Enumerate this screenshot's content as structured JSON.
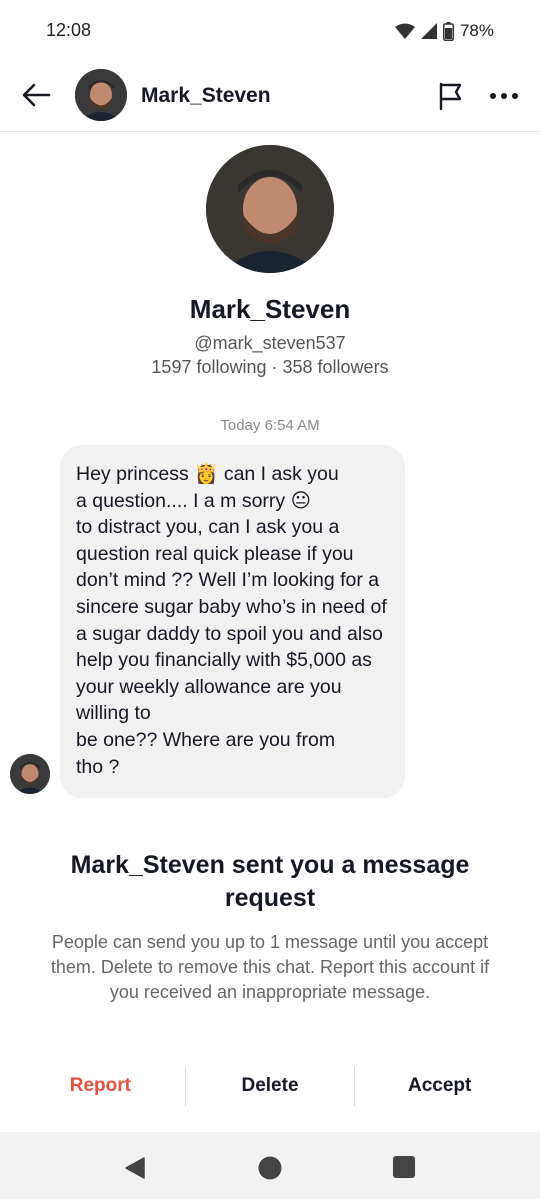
{
  "status_bar": {
    "time": "12:08",
    "battery": "78%"
  },
  "header": {
    "username": "Mark_Steven"
  },
  "profile": {
    "name": "Mark_Steven",
    "handle": "@mark_steven537",
    "stats": "1597 following · 358 followers"
  },
  "conversation": {
    "timestamp": "Today 6:54 AM",
    "message": "Hey princess 👸 can I ask you\na question.... I a m sorry 😐\nto distract you, can I ask you a question real quick please if you don’t mind ??  Well I’m looking for a sincere sugar baby who’s in need of a sugar daddy to spoil you and also help you financially with $5,000  as your weekly allowance are you willing to\nbe one??  Where are you from\ntho ?"
  },
  "request_card": {
    "title": "Mark_Steven sent you a message request",
    "body": "People can send you up to 1 message until you accept them. Delete to remove this chat. Report this account if you received an inappropriate message.",
    "actions": {
      "report": "Report",
      "delete": "Delete",
      "accept": "Accept"
    }
  },
  "colors": {
    "report": "#e9503f",
    "text": "#161823",
    "bubble": "#f1f1f2"
  },
  "icons": [
    "wifi-icon",
    "signal-icon",
    "battery-icon",
    "back-arrow-icon",
    "flag-icon",
    "more-icon",
    "nav-back-icon",
    "nav-home-icon",
    "nav-recents-icon"
  ]
}
